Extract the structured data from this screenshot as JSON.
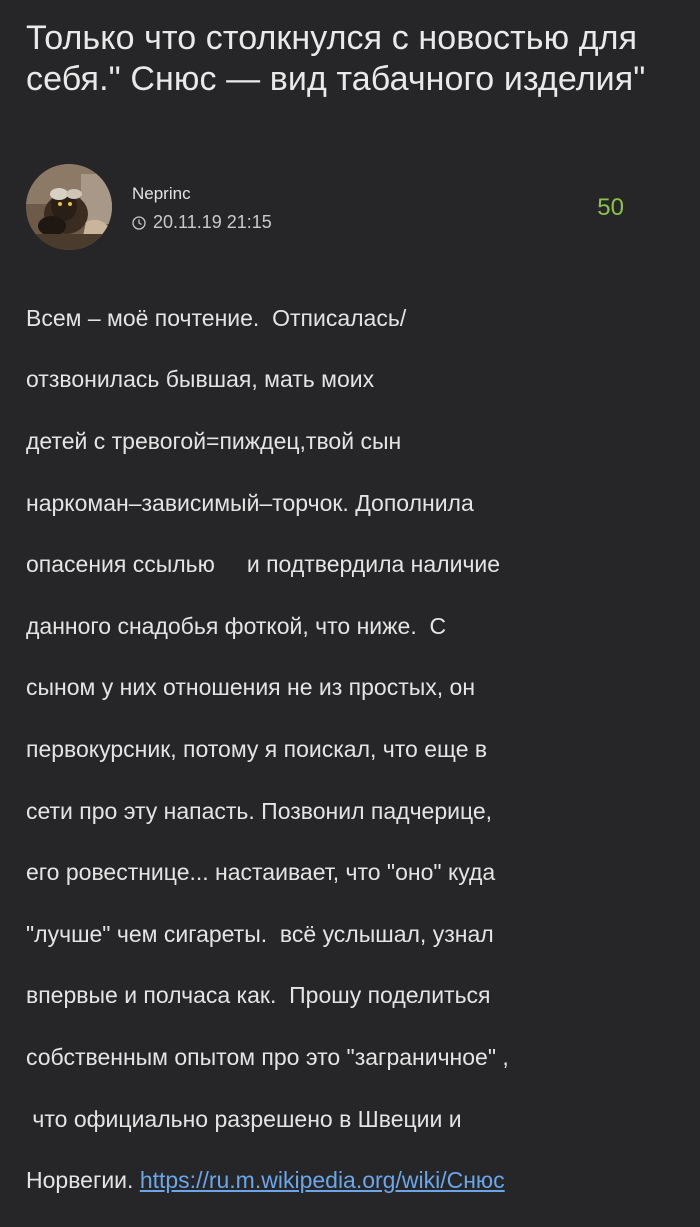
{
  "post": {
    "title": "Только что столкнулся с новостью для себя.\" Снюс — вид табачного изделия\"",
    "author": {
      "name": "Neprinc",
      "avatar_icon": "goat-avatar"
    },
    "datetime": "20.11.19 21:15",
    "rating": "50",
    "body_lines": [
      "Всем – моё почтение.  Отписалась/",
      "отзвонилась бывшая, мать моих",
      "детей с тревогой=пиждец,твой сын",
      "наркоман–зависимый–торчок. Дополнила",
      "опасения ссылью     и подтвердила наличие",
      "данного снадобья фоткой, что ниже.  С",
      "сыном у них отношения не из простых, он",
      "первокурсник, потому я поискал, что еще в",
      "сети про эту напасть. Позвонил падчерице,",
      "его ровестнице... настаивает, что \"оно\" куда",
      "\"лучше\" чем сигареты.  всё услышал, узнал",
      "впервые и полчаса как.  Прошу поделиться",
      "собственным опытом про это \"заграничное\" ,",
      " что официально разрешено в Швеции и",
      "Норвегии. "
    ],
    "link_text": "https://ru.m.wikipedia.org/wiki/Снюс",
    "colors": {
      "background": "#262628",
      "rating": "#8bc34a",
      "link": "#6aa6e8"
    }
  }
}
